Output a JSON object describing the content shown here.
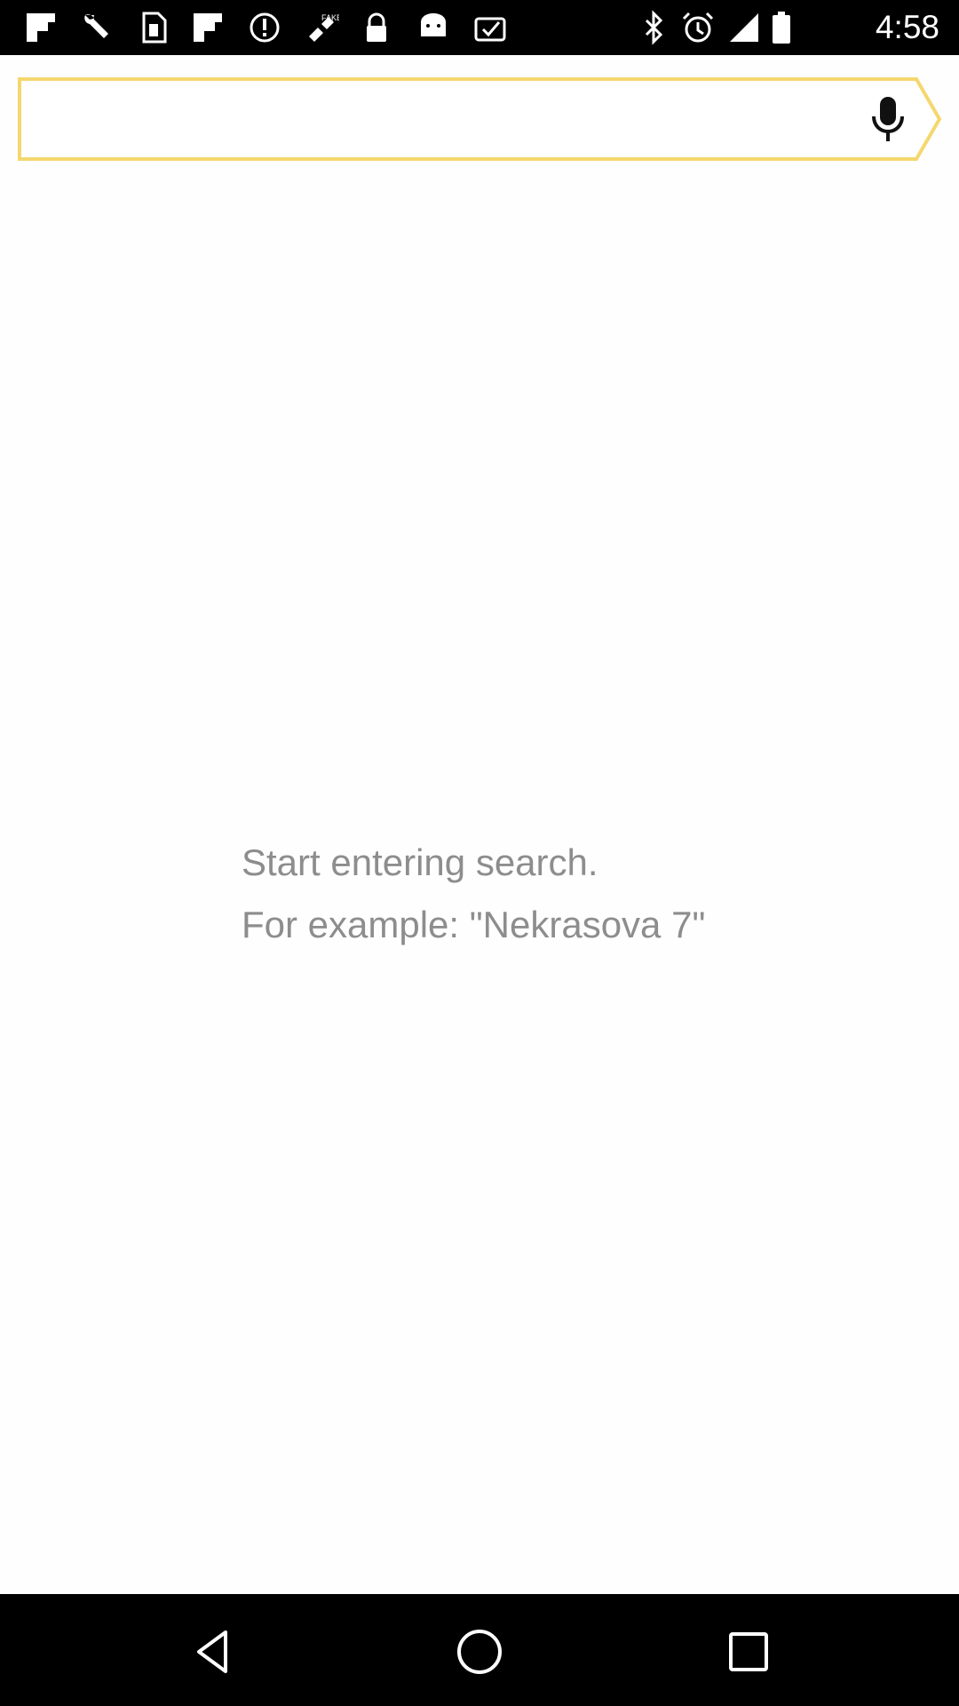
{
  "status_bar": {
    "time": "4:58",
    "icons": [
      "flipboard-icon",
      "wrench-icon",
      "sim-card-icon",
      "flipboard-icon",
      "alert-icon",
      "fake-gps-icon",
      "lock-icon",
      "android-icon",
      "clipboard-check-icon",
      "bluetooth-icon",
      "alarm-icon",
      "signal-icon",
      "battery-icon"
    ]
  },
  "search": {
    "value": "",
    "placeholder": "",
    "accent_color": "#f5d76e",
    "mic_icon": "microphone-icon"
  },
  "hint": {
    "line1": "Start entering search.",
    "line2": "For example: \"Nekrasova 7\""
  },
  "nav_bar": {
    "back_icon": "back-triangle-icon",
    "home_icon": "home-circle-icon",
    "recents_icon": "recents-square-icon"
  }
}
